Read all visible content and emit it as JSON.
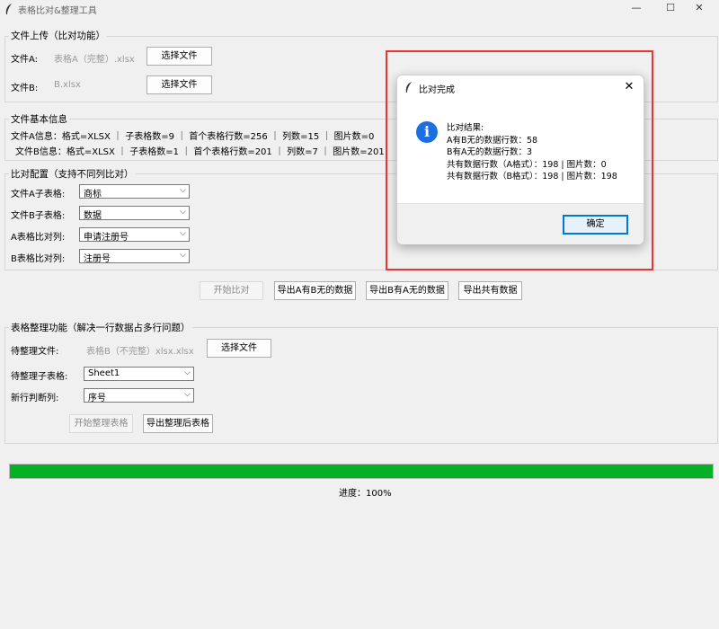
{
  "window": {
    "title": "表格比对&整理工具",
    "minimize_glyph": "—",
    "maximize_glyph": "☐",
    "close_glyph": "✕"
  },
  "upload": {
    "header": "文件上传（比对功能）",
    "file_a_label": "文件A:",
    "file_a_value": "表格A（完整）.xlsx",
    "file_b_label": "文件B:",
    "file_b_value": "B.xlsx",
    "choose_button": "选择文件"
  },
  "info": {
    "header": "文件基本信息",
    "file_a": "文件A信息：格式=XLSX ｜ 子表格数=9 ｜ 首个表格行数=256 ｜ 列数=15 ｜ 图片数=0",
    "file_b": "文件B信息：格式=XLSX ｜ 子表格数=1 ｜ 首个表格行数=201 ｜ 列数=7 ｜ 图片数=201"
  },
  "config": {
    "header": "比对配置（支持不同列比对）",
    "rows": [
      {
        "label": "文件A子表格:",
        "value": "商标"
      },
      {
        "label": "文件B子表格:",
        "value": "数据"
      },
      {
        "label": "A表格比对列:",
        "value": "申请注册号"
      },
      {
        "label": "B表格比对列:",
        "value": "注册号"
      }
    ],
    "chevron": "⌵"
  },
  "actions": {
    "start_compare": "开始比对",
    "export_a_not_b": "导出A有B无的数据",
    "export_b_not_a": "导出B有A无的数据",
    "export_common": "导出共有数据"
  },
  "organize": {
    "header": "表格整理功能（解决一行数据占多行问题）",
    "file_label": "待整理文件:",
    "file_value": "表格B（不完整）xlsx.xlsx",
    "choose_button": "选择文件",
    "sheet_label": "待整理子表格:",
    "sheet_value": "Sheet1",
    "break_label": "新行判断列:",
    "break_value": "序号",
    "start_button": "开始整理表格",
    "export_button": "导出整理后表格"
  },
  "progress": {
    "fraction": 1.0,
    "text": "进度：100%",
    "color": "#06b025"
  },
  "dialog": {
    "title": "比对完成",
    "close_glyph": "✕",
    "icon": "i",
    "lines": [
      "比对结果:",
      "A有B无的数据行数：58",
      "B有A无的数据行数：3",
      "共有数据行数（A格式）：198 | 图片数：0",
      "共有数据行数（B格式）：198 | 图片数：198"
    ],
    "ok_button": "确定"
  },
  "colors": {
    "highlight": "#e33333",
    "accent": "#0078d7",
    "info_icon": "#1c6fe0"
  }
}
